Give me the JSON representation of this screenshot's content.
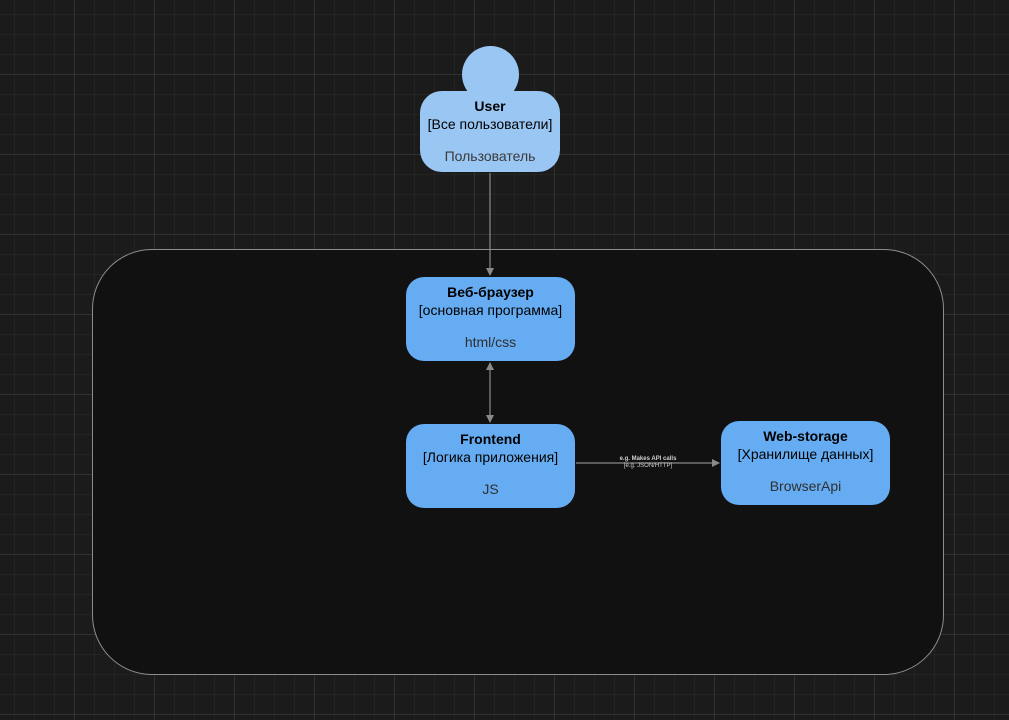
{
  "diagram": {
    "person": {
      "name": "User",
      "kind": "[Все пользователи]",
      "tech": "Пользователь"
    },
    "containers": [
      {
        "name": "Веб-браузер",
        "kind": "[основная программа]",
        "tech": "html/css"
      },
      {
        "name": "Frontend",
        "kind": "[Логика приложения]",
        "tech": "JS"
      },
      {
        "name": "Web-storage",
        "kind": "[Хранилище данных]",
        "tech": "BrowserApi"
      }
    ],
    "relations": [
      {
        "from": "User",
        "to": "Веб-браузер",
        "label": ""
      },
      {
        "from": "Веб-браузер",
        "to": "Frontend",
        "label": ""
      },
      {
        "from": "Frontend",
        "to": "Web-storage",
        "label": "e.g. Makes API calls",
        "tech": "[e.g. JSON/HTTP]"
      }
    ]
  },
  "colors": {
    "person_fill": "#9ac6f4",
    "container_fill": "#66acf2",
    "boundary_stroke": "#8d8d8d",
    "edge_stroke": "#8a8a8a"
  }
}
